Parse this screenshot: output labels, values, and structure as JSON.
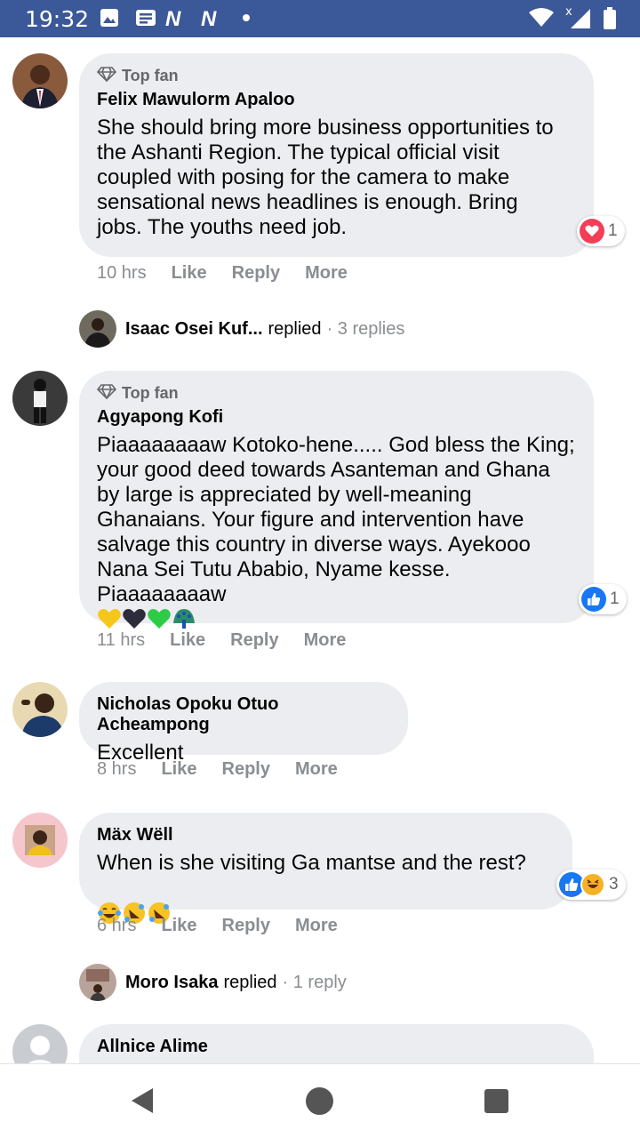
{
  "status_bar": {
    "time": "19:32",
    "icons": [
      "gallery-icon",
      "mail-icon",
      "n-app-icon",
      "n-app-icon",
      "dot-icon",
      "wifi-icon",
      "signal-icon",
      "battery-icon"
    ],
    "n1": "N",
    "n2": "N"
  },
  "colors": {
    "status_bar": "#3b5898",
    "bubble": "#ebedf0",
    "meta_text": "#8a8d91",
    "like_blue": "#1877f2",
    "heart_red": "#f33e58"
  },
  "comments": [
    {
      "badge": "Top fan",
      "author": "Felix Mawulorm Apaloo",
      "text": "She should bring more business opportunities to\nthe Ashanti Region. The typical official visit\ncoupled with posing for the camera to make\nsensational news headlines is enough. Bring\njobs. The youths need job.",
      "time": "10 hrs",
      "like": "Like",
      "reply": "Reply",
      "more": "More",
      "reaction_count": "1",
      "reaction_icons": [
        "heart-icon"
      ]
    },
    {
      "badge": "Top fan",
      "author": "Agyapong Kofi",
      "text": "Piaaaaaaaaw Kotoko-hene..... God bless the King;\nyour good deed towards Asanteman and Ghana\nby large is appreciated by well-meaning\nGhanaians. Your figure and intervention have\nsalvage this country in diverse ways. Ayekooo\nNana Sei Tutu Ababio, Nyame kesse.\nPiaaaaaaaaw",
      "emojis": [
        "yellow-heart-icon",
        "black-heart-icon",
        "green-heart-icon",
        "peacock-icon"
      ],
      "time": "11 hrs",
      "like": "Like",
      "reply": "Reply",
      "more": "More",
      "reaction_count": "1",
      "reaction_icons": [
        "like-icon"
      ]
    },
    {
      "author": "Nicholas Opoku Otuo Acheampong",
      "text": "Excellent",
      "time": "8 hrs",
      "like": "Like",
      "reply": "Reply",
      "more": "More"
    },
    {
      "author": "Mäx Wëll",
      "text": "When is she visiting Ga mantse and the rest?",
      "emojis": [
        "tears-of-joy-icon",
        "rofl-icon",
        "rofl-icon"
      ],
      "time": "6 hrs",
      "like": "Like",
      "reply": "Reply",
      "more": "More",
      "reaction_count": "3",
      "reaction_icons": [
        "like-icon",
        "haha-icon"
      ]
    },
    {
      "author": "Allnice Alime"
    }
  ],
  "replies": [
    {
      "name": "Isaac Osei Kuf...",
      "word": "replied",
      "count": "· 3 replies"
    },
    {
      "name": "Moro Isaka",
      "word": "replied",
      "count": "· 1 reply"
    }
  ],
  "nav": [
    "back-icon",
    "home-icon",
    "recents-icon"
  ]
}
